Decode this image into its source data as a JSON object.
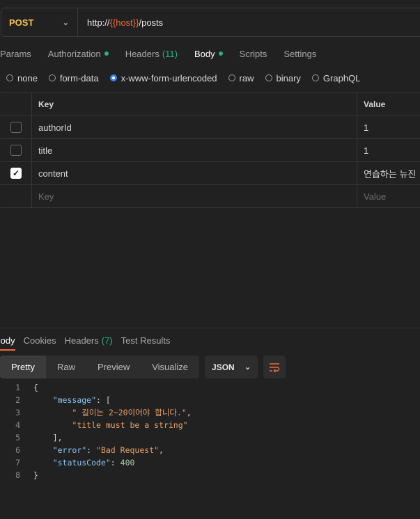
{
  "request": {
    "method": "POST",
    "url_prefix": "http://",
    "url_var": "{{host}}",
    "url_suffix": "/posts"
  },
  "request_tabs": [
    {
      "label": "Params"
    },
    {
      "label": "Authorization"
    },
    {
      "label": "Headers",
      "count": "(11)"
    },
    {
      "label": "Body"
    },
    {
      "label": "Scripts"
    },
    {
      "label": "Settings"
    }
  ],
  "body_types": [
    "none",
    "form-data",
    "x-www-form-urlencoded",
    "raw",
    "binary",
    "GraphQL"
  ],
  "params_table": {
    "header_key": "Key",
    "header_value": "Value",
    "rows": [
      {
        "key": "authorId",
        "value": "1",
        "checked": false
      },
      {
        "key": "title",
        "value": "1",
        "checked": false
      },
      {
        "key": "content",
        "value": "연습하는 뉴진",
        "checked": true
      }
    ],
    "placeholder_key": "Key",
    "placeholder_value": "Value"
  },
  "response_tabs": [
    {
      "label": "Body"
    },
    {
      "label": "Cookies"
    },
    {
      "label": "Headers",
      "count": "(7)"
    },
    {
      "label": "Test Results"
    }
  ],
  "view_modes": [
    "Pretty",
    "Raw",
    "Preview",
    "Visualize"
  ],
  "format": "JSON",
  "code_lines": [
    "1",
    "2",
    "3",
    "4",
    "5",
    "6",
    "7",
    "8"
  ],
  "response_json": {
    "open_brace": "{",
    "message_key": "\"message\"",
    "message_vals": [
      "\" 길이는 2~20이어야 합니다.\"",
      "\"title must be a string\""
    ],
    "error_key": "\"error\"",
    "error_val": "\"Bad Request\"",
    "status_key": "\"statusCode\"",
    "status_val": "400",
    "close_brace": "}"
  },
  "colors": {
    "accent": "#f26b3a",
    "success": "#24b47e",
    "method": "#f2c14e",
    "radio": "#3b82f6"
  }
}
